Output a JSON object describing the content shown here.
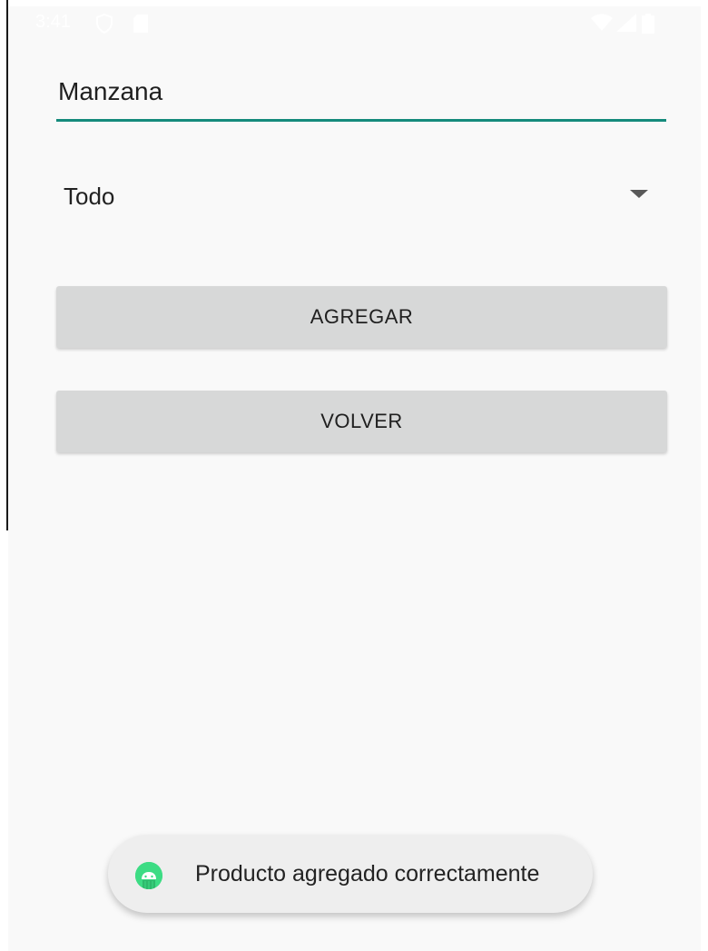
{
  "status_bar": {
    "time": "3:41"
  },
  "form": {
    "name_value": "Manzana",
    "category_value": "Todo",
    "add_button_label": "AGREGAR",
    "back_button_label": "VOLVER"
  },
  "toast": {
    "message": "Producto agregado correctamente",
    "icon": "android-icon"
  },
  "colors": {
    "accent": "#158b7c",
    "button_bg": "#d7d8d8",
    "toast_icon": "#3ddc84"
  }
}
